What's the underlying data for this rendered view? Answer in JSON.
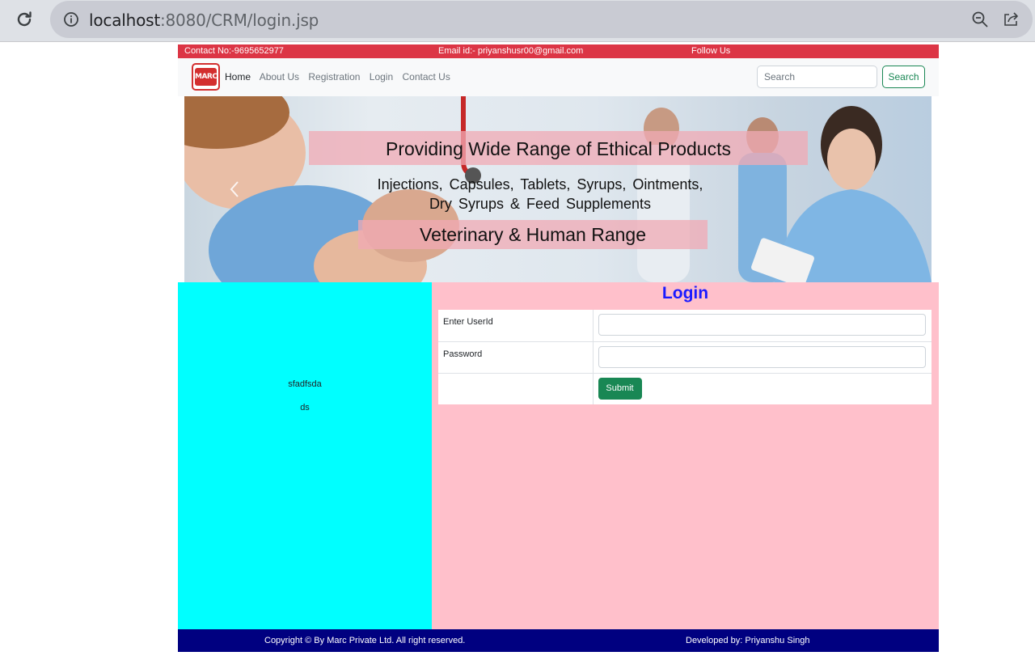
{
  "browser": {
    "url_host": "localhost",
    "url_rest": ":8080/CRM/login.jsp"
  },
  "topbar": {
    "contact": "Contact No:-9695652977",
    "email": "Email id:- priyanshusr00@gmail.com",
    "follow": "Follow Us"
  },
  "navbar": {
    "logo_text": "MARC",
    "links": [
      "Home",
      "About Us",
      "Registration",
      "Login",
      "Contact Us"
    ],
    "search_placeholder": "Search",
    "search_button": "Search"
  },
  "banner": {
    "title": "Providing Wide Range of Ethical Products",
    "line1": "Injections, Capsules, Tablets, Syrups, Ointments,",
    "line2": "Dry Syrups & Feed Supplements",
    "range": "Veterinary & Human Range"
  },
  "sidebar": {
    "text1": "sfadfsda",
    "text2": "ds"
  },
  "login": {
    "title": "Login",
    "userid_label": "Enter UserId",
    "password_label": "Password",
    "submit_label": "Submit"
  },
  "footer": {
    "copyright": "Copyright © By Marc Private Ltd. All right reserved.",
    "developer": "Developed by: Priyanshu Singh"
  },
  "colors": {
    "topbar": "#dc3545",
    "sidebar": "#00ffff",
    "main_bg": "#ffc0cb",
    "login_title": "#1a1aff",
    "footer": "#000080",
    "submit": "#198754"
  }
}
